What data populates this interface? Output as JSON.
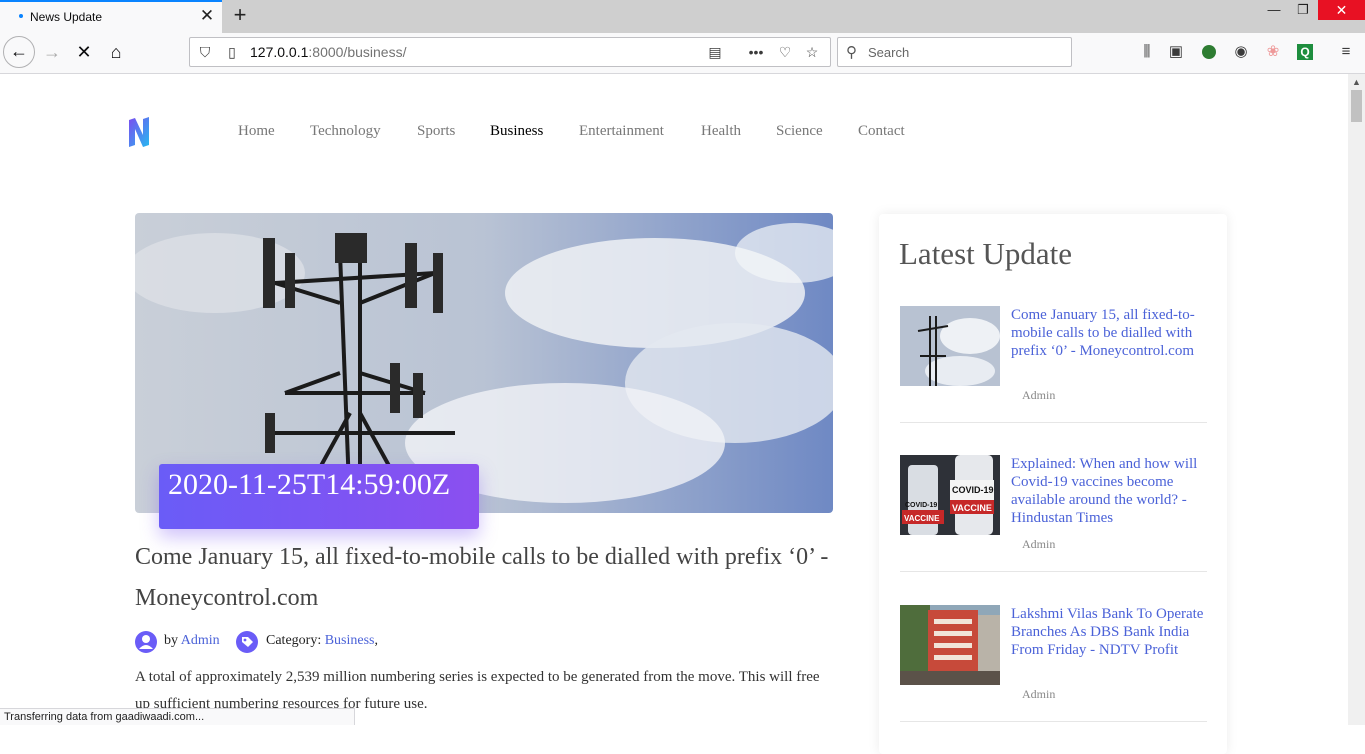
{
  "browser": {
    "tab_title": "News Update",
    "url_host": "127.0.0.1",
    "url_rest": ":8000/business/",
    "search_placeholder": "Search",
    "status": "Transferring data from gaadiwaadi.com..."
  },
  "site": {
    "nav": [
      "Home",
      "Technology",
      "Sports",
      "Business",
      "Entertainment",
      "Health",
      "Science",
      "Contact"
    ],
    "active_nav": "Business"
  },
  "article": {
    "date": "2020-11-25T14:59:00Z",
    "title": "Come January 15, all fixed-to-mobile calls to be dialled with prefix ‘0’ - Moneycontrol.com",
    "by_label": "by",
    "author": "Admin",
    "category_label": "Category:",
    "category": "Business",
    "category_suffix": ",",
    "description": "A total of approximately 2,539 million numbering series is expected to be generated from the move. This will free up sufficient numbering resources for future use."
  },
  "sidebar": {
    "title": "Latest Update",
    "items": [
      {
        "title": "Come January 15, all fixed-to-mobile calls to be dialled with prefix ‘0’ - Moneycontrol.com",
        "author": "Admin"
      },
      {
        "title": "Explained: When and how will Covid-19 vaccines become available around the world? - Hindustan Times",
        "author": "Admin",
        "thumb_text_1": "COVID-19",
        "thumb_text_2": "VACCINE"
      },
      {
        "title": "Lakshmi Vilas Bank To Operate Branches As DBS Bank India From Friday - NDTV Profit",
        "author": "Admin"
      }
    ]
  },
  "colors": {
    "accent": "#6a5cf7",
    "link": "#4b62d8",
    "tab_indicator": "#0a84ff",
    "close_red": "#e81123"
  }
}
